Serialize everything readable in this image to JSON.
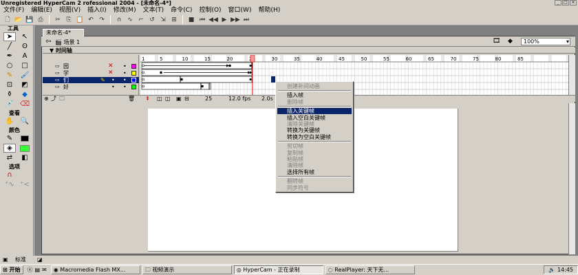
{
  "title_bar": {
    "text": "Unregistered HyperCam 2 rofessional 2004 - [未命名-4*]"
  },
  "menu": [
    "文件(F)",
    "编辑(E)",
    "视图(V)",
    "插入(I)",
    "修改(M)",
    "文本(T)",
    "命令(C)",
    "控制(O)",
    "窗口(W)",
    "帮助(H)"
  ],
  "tools": {
    "header": "工具",
    "view_label": "查看",
    "colors_label": "颜色",
    "options_label": "选项"
  },
  "document": {
    "tab": "未命名-4*",
    "scene": "场景 1",
    "zoom": "100%",
    "timeline_label": "时间轴"
  },
  "layers": [
    {
      "name": "园",
      "active": false
    },
    {
      "name": "学",
      "active": false
    },
    {
      "name": "们",
      "active": true
    },
    {
      "name": "好",
      "active": false
    }
  ],
  "ruler": [
    "1",
    "5",
    "10",
    "15",
    "20",
    "25",
    "30",
    "35",
    "40",
    "45",
    "50",
    "55",
    "60",
    "65",
    "70",
    "75",
    "80",
    "85"
  ],
  "timeline_footer": {
    "frame": "25",
    "fps": "12.0 fps",
    "time": "2.0s"
  },
  "context_menu": [
    {
      "label": "创建补间动画",
      "enabled": false,
      "highlighted": false
    },
    {
      "sep": true
    },
    {
      "label": "插入帧",
      "enabled": true,
      "highlighted": false
    },
    {
      "label": "删除帧",
      "enabled": false,
      "highlighted": false
    },
    {
      "sep": true
    },
    {
      "label": "插入关键帧",
      "enabled": true,
      "highlighted": true
    },
    {
      "label": "插入空白关键帧",
      "enabled": true,
      "highlighted": false
    },
    {
      "label": "清除关键帧",
      "enabled": false,
      "highlighted": false
    },
    {
      "label": "转换为关键帧",
      "enabled": true,
      "highlighted": false
    },
    {
      "label": "转换为空白关键帧",
      "enabled": true,
      "highlighted": false
    },
    {
      "sep": true
    },
    {
      "label": "剪切帧",
      "enabled": false,
      "highlighted": false
    },
    {
      "label": "复制帧",
      "enabled": false,
      "highlighted": false
    },
    {
      "label": "粘贴帧",
      "enabled": false,
      "highlighted": false
    },
    {
      "label": "清除帧",
      "enabled": false,
      "highlighted": false
    },
    {
      "label": "选择所有帧",
      "enabled": true,
      "highlighted": false
    },
    {
      "sep": true
    },
    {
      "label": "翻转帧",
      "enabled": false,
      "highlighted": false
    },
    {
      "label": "同步符号",
      "enabled": false,
      "highlighted": false
    }
  ],
  "properties_label": "标准",
  "taskbar": {
    "start": "开始",
    "tasks": [
      "Macromedia Flash MX...",
      "视频演示",
      "HyperCam - 正在录制",
      "RealPlayer: 天下无..."
    ],
    "clock": "14:45"
  }
}
